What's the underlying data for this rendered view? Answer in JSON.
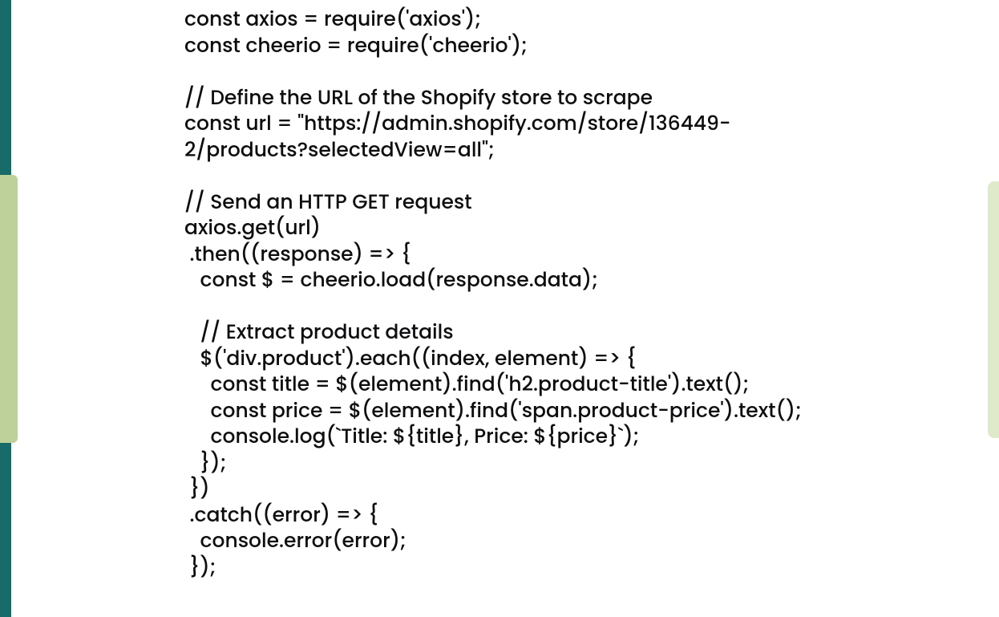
{
  "code_lines": [
    "const axios = require('axios');",
    "const cheerio = require('cheerio');",
    "",
    "// Define the URL of the Shopify store to scrape",
    "const url = \"https://admin.shopify.com/­store/136449-2/products?selectedView=all\";",
    "",
    "// Send an HTTP GET request",
    "axios.get(url)",
    " .then((response) => {",
    "   const $ = cheerio.load(response.data);",
    "",
    "   // Extract product details",
    "   $('div.product').each((index, element) => {",
    "     const title = $(element).find('h2.product-title').text();",
    "     const price = $(element).find('span.product-price').­text();",
    "     console.log(`Title: ${title}, Price: ${price}`);",
    "   });",
    " })",
    " .catch((error) => {",
    "   console.error(error);",
    " });"
  ],
  "colors": {
    "teal": "#176b68",
    "olive": "#bed19a",
    "right_bar": "#dfeacb",
    "text": "#0e0e10"
  }
}
